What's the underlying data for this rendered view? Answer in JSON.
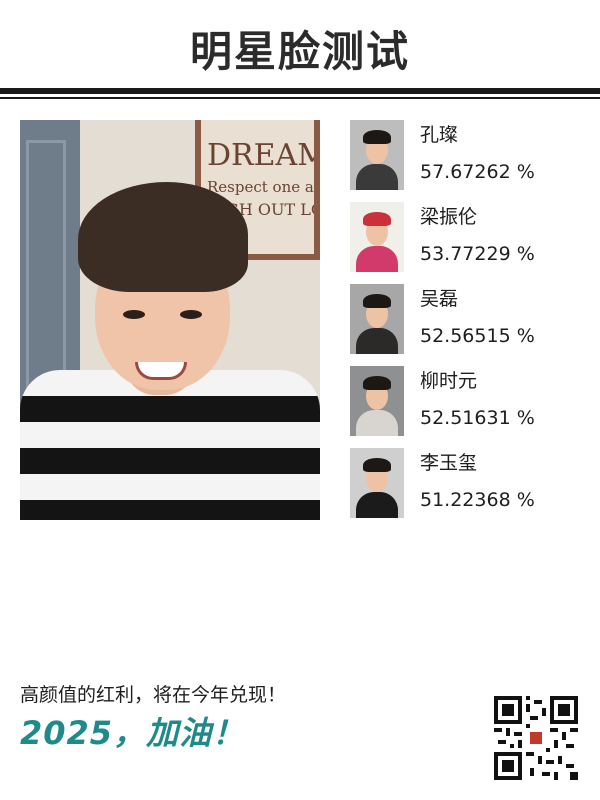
{
  "header": {
    "title": "明星脸测试"
  },
  "main_photo": {
    "sign_line1": "DREAM I",
    "sign_line2": "Respect one an",
    "sign_line3": "AUGH OUT LO"
  },
  "matches": [
    {
      "name": "孔璨",
      "score": "57.67262 %"
    },
    {
      "name": "梁振伦",
      "score": "53.77229 %"
    },
    {
      "name": "吴磊",
      "score": "52.56515 %"
    },
    {
      "name": "柳时元",
      "score": "52.51631 %"
    },
    {
      "name": "李玉玺",
      "score": "51.22368 %"
    }
  ],
  "footer": {
    "slogan": "高颜值的红利，将在今年兑现！",
    "cheer": "2025，加油！"
  },
  "colors": {
    "accent_teal": "#1f8a8a",
    "title": "#2b2b2b"
  }
}
